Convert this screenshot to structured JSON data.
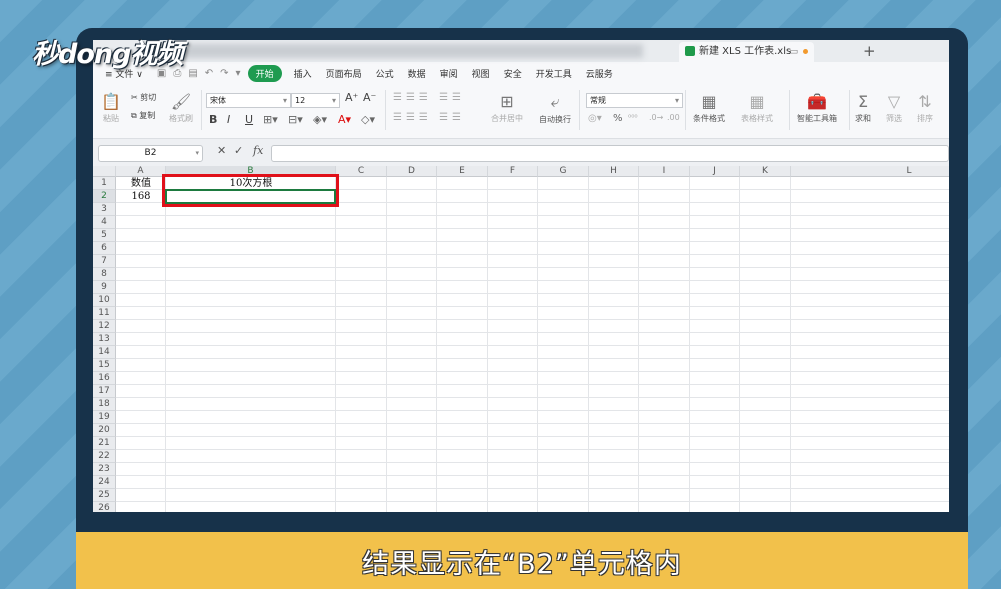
{
  "watermark": "秒dong视频",
  "window": {
    "doc_tab": "新建 XLS 工作表.xls",
    "new_tab": "+"
  },
  "menu": {
    "file": "≡ 文件 ∨",
    "start": "开始",
    "items": [
      "插入",
      "页面布局",
      "公式",
      "数据",
      "审阅",
      "视图",
      "安全",
      "开发工具",
      "云服务"
    ]
  },
  "ribbon": {
    "paste": "粘贴",
    "cut": "剪切",
    "copy": "复制",
    "format_painter": "格式刷",
    "font_name": "宋体",
    "font_size": "12",
    "grow": "A⁺",
    "shrink": "A⁻",
    "bold": "B",
    "italic": "I",
    "underline": "U",
    "merge_center": "合并居中",
    "wrap_text": "自动换行",
    "number_format": "常规",
    "percent": "%",
    "cond_format": "条件格式",
    "table_style": "表格样式",
    "smart_toolbox": "智能工具箱",
    "sum": "求和",
    "filter": "筛选",
    "sort": "排序"
  },
  "formula_bar": {
    "name_box": "B2",
    "cancel": "✕",
    "confirm": "✓",
    "fx": "fx",
    "value": ""
  },
  "sheet": {
    "columns": [
      "A",
      "B",
      "C",
      "D",
      "E",
      "F",
      "G",
      "H",
      "I",
      "J",
      "K",
      "L"
    ],
    "rows": [
      "1",
      "2",
      "3",
      "4",
      "5",
      "6",
      "7",
      "8",
      "9",
      "10",
      "11",
      "12",
      "13",
      "14",
      "15",
      "16",
      "17",
      "18",
      "19",
      "20",
      "21",
      "22",
      "23",
      "24",
      "25",
      "26"
    ],
    "cells": {
      "A1": "数值",
      "B1": "10次方根",
      "A2": "168",
      "B2": ""
    },
    "active_cell": "B2"
  },
  "caption": "结果显示在“B2”单元格内",
  "colors": {
    "accent_green": "#1e9b50",
    "highlight_red": "#e0101a",
    "caption_bg": "#f2c14b"
  }
}
